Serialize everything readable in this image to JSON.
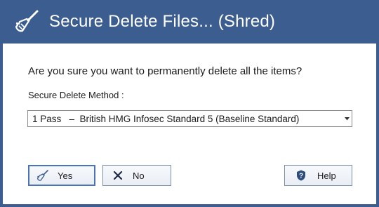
{
  "window": {
    "title": "Secure Delete Files... (Shred)",
    "title_icon": "broom-icon"
  },
  "dialog": {
    "question": "Are you sure you want to permanently delete all the items?",
    "method_label": "Secure Delete Method :",
    "method_selected": "1 Pass   –  British HMG Infosec Standard 5 (Baseline Standard)"
  },
  "buttons": {
    "yes_label": "Yes",
    "no_label": "No",
    "help_label": "Help"
  },
  "colors": {
    "titlebar": "#3c5d8f",
    "accent": "#4a74b4",
    "help_icon": "#2e4c7e"
  }
}
